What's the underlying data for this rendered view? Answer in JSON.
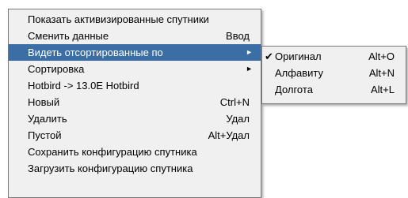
{
  "main_menu": {
    "items": [
      {
        "label": "Показать активизированные спутники",
        "shortcut": ""
      },
      {
        "label": "Сменить данные",
        "shortcut": "Ввод"
      },
      {
        "label": "Видеть отсортированные по",
        "shortcut": "",
        "arrow": "►"
      },
      {
        "label": "Сортировка",
        "shortcut": "",
        "arrow": "►"
      },
      {
        "label": "Hotbird -> 13.0E Hotbird",
        "shortcut": ""
      },
      {
        "label": "Новый",
        "shortcut": "Ctrl+N"
      },
      {
        "label": "Удалить",
        "shortcut": "Удал"
      },
      {
        "label": "Пустой",
        "shortcut": "Alt+Удал"
      },
      {
        "label": "Сохранить конфигурацию спутника",
        "shortcut": ""
      },
      {
        "label": "Загрузить конфигурацию спутника",
        "shortcut": ""
      }
    ],
    "selected_index": 2
  },
  "sub_menu": {
    "items": [
      {
        "label": "Оригинал",
        "shortcut": "Alt+O",
        "check": "✔"
      },
      {
        "label": "Алфавиту",
        "shortcut": "Alt+N"
      },
      {
        "label": "Долгота",
        "shortcut": "Alt+L"
      }
    ]
  },
  "colors": {
    "menu_bg": "#f0f0f0",
    "highlight": "#3a6ea5",
    "highlight_text": "#ffffff",
    "border": "#7a7a7a"
  }
}
